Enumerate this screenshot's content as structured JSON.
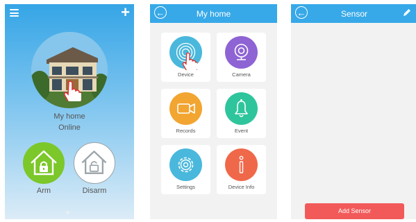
{
  "home_screen": {
    "home_name": "My home",
    "status": "Online",
    "arm_label": "Arm",
    "disarm_label": "Disarm"
  },
  "menu_screen": {
    "title": "My home",
    "items": [
      {
        "label": "Device",
        "icon": "fingerprint-icon",
        "color": "#4ab8dc"
      },
      {
        "label": "Camera",
        "icon": "webcam-icon",
        "color": "#8e63d4"
      },
      {
        "label": "Records",
        "icon": "video-camera-icon",
        "color": "#f2a531"
      },
      {
        "label": "Event",
        "icon": "bell-icon",
        "color": "#2fc59c"
      },
      {
        "label": "Settings",
        "icon": "gear-icon",
        "color": "#4ab8dc"
      },
      {
        "label": "Device Info",
        "icon": "info-icon",
        "color": "#f0684a"
      }
    ]
  },
  "sensor_screen": {
    "title": "Sensor",
    "add_button": "Add Sensor"
  },
  "colors": {
    "header": "#37a9e8",
    "arm": "#7cc72a",
    "add_button": "#f25a5a"
  }
}
